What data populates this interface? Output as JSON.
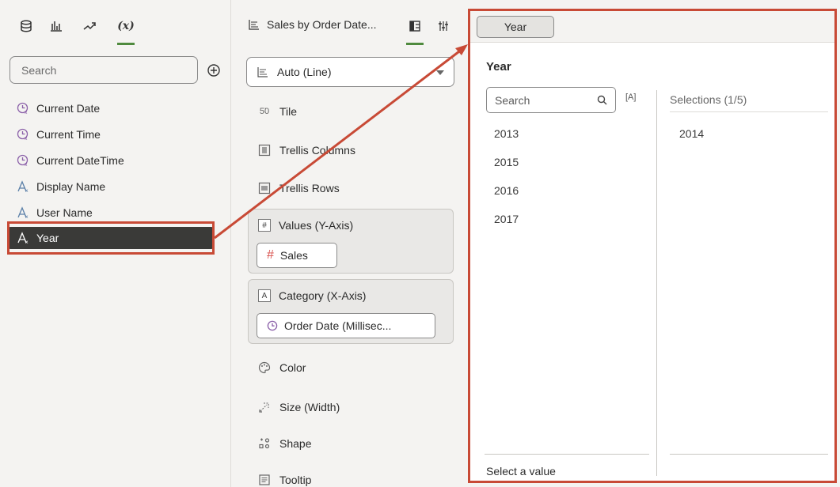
{
  "left_panel": {
    "tabs": [
      {
        "icon": "database-icon"
      },
      {
        "icon": "bar-chart-icon"
      },
      {
        "icon": "trend-arrow-icon"
      },
      {
        "label": "(x)",
        "icon": "calculation-icon"
      }
    ],
    "search": {
      "placeholder": "Search"
    },
    "calculations": [
      {
        "label": "Current Date",
        "icon": "clock-function-icon"
      },
      {
        "label": "Current Time",
        "icon": "clock-function-icon"
      },
      {
        "label": "Current DateTime",
        "icon": "clock-function-icon"
      },
      {
        "label": "Display Name",
        "icon": "text-function-icon"
      },
      {
        "label": "User Name",
        "icon": "text-function-icon"
      },
      {
        "label": "Year",
        "icon": "text-function-icon",
        "selected": true
      }
    ]
  },
  "middle_panel": {
    "viz_title": "Sales by Order Date...",
    "viz_type": "Auto (Line)",
    "grammar": {
      "tile": "Tile",
      "tile_icon_text": "5̈0",
      "trellis_columns": "Trellis Columns",
      "trellis_rows": "Trellis Rows",
      "values_label": "Values (Y-Axis)",
      "values_pill": "Sales",
      "category_label": "Category (X-Axis)",
      "category_pill": "Order Date (Millisec...",
      "color": "Color",
      "size": "Size (Width)",
      "shape": "Shape",
      "tooltip": "Tooltip"
    }
  },
  "filter_panel": {
    "tab_label": "Year",
    "title": "Year",
    "search_placeholder": "Search",
    "values": [
      "2013",
      "2015",
      "2016",
      "2017"
    ],
    "selections_label": "Selections (1/5)",
    "selected_values": [
      "2014"
    ],
    "footer": "Select a value"
  },
  "colors": {
    "highlight": "#c84a36",
    "active_tab": "#4f8a3e",
    "calc_icon_clock": "#8a5fa8",
    "calc_icon_text": "#5a7fa8",
    "pill_number": "#d9534f"
  }
}
